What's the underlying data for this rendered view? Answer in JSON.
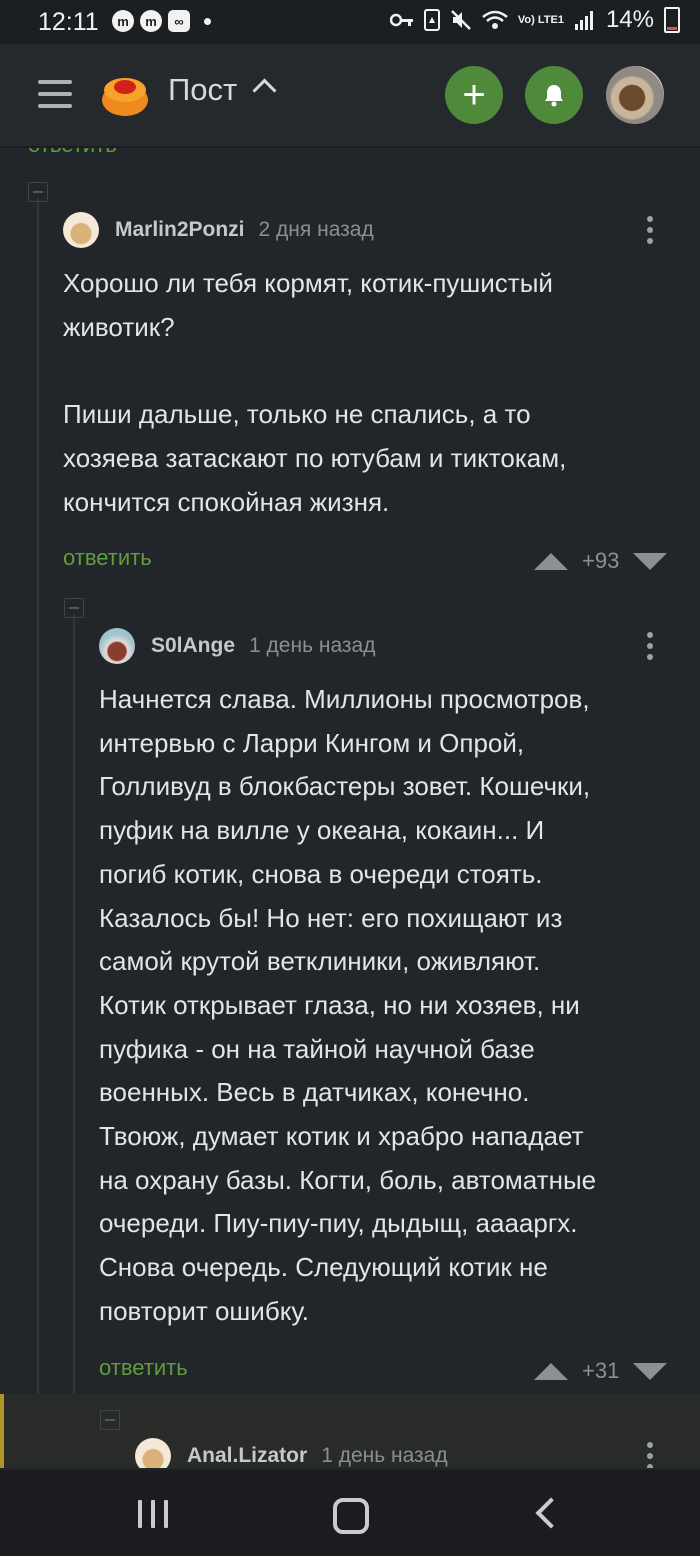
{
  "status": {
    "time": "12:11",
    "left_icons": [
      "m",
      "m",
      "∞"
    ],
    "network": "Vo) LTE1",
    "battery": "14%"
  },
  "header": {
    "title": "Пост",
    "add_label": "+"
  },
  "previous": {
    "reply_label": "ответить"
  },
  "comments": [
    {
      "author": "Marlin2Ponzi",
      "time": "2 дня назад",
      "body": "Хорошо ли тебя кормят, котик-пушистый\nживотик?\n\nПиши дальше, только не спались, а то\nхозяева затаскают по ютубам и тиктокам,\nкончится спокойная жизня.",
      "reply_label": "ответить",
      "score": "+93"
    },
    {
      "author": "S0lAnge",
      "time": "1 день назад",
      "body": "Начнется слава. Миллионы просмотров,\nинтервью с Ларри Кингом и Опрой,\nГолливуд в блокбастеры зовет. Кошечки,\nпуфик на вилле у океана, кокаин... И\nпогиб котик, снова в очереди стоять.\nКазалось бы! Но нет: его похищают из\nсамой крутой ветклиники, оживляют.\nКотик открывает глаза, но ни хозяев, ни\nпуфика - он на тайной научной базе\nвоенных. Весь в датчиках, конечно.\nТвоюж, думает котик и храбро нападает\nна охрану базы. Когти, боль, автоматные\nочереди. Пиу-пиу-пиу, дыдыщ, ааааргх.\nСнова очередь. Следующий котик не\nповторит ошибку.",
      "reply_label": "ответить",
      "score": "+31"
    },
    {
      "author": "Anal.Lizator",
      "time": "1 день назад"
    }
  ],
  "colors": {
    "background": "#222529",
    "accent_green": "#4f8a3b",
    "reply_green": "#5e9e3c",
    "new_comment_bar": "#b09522"
  }
}
